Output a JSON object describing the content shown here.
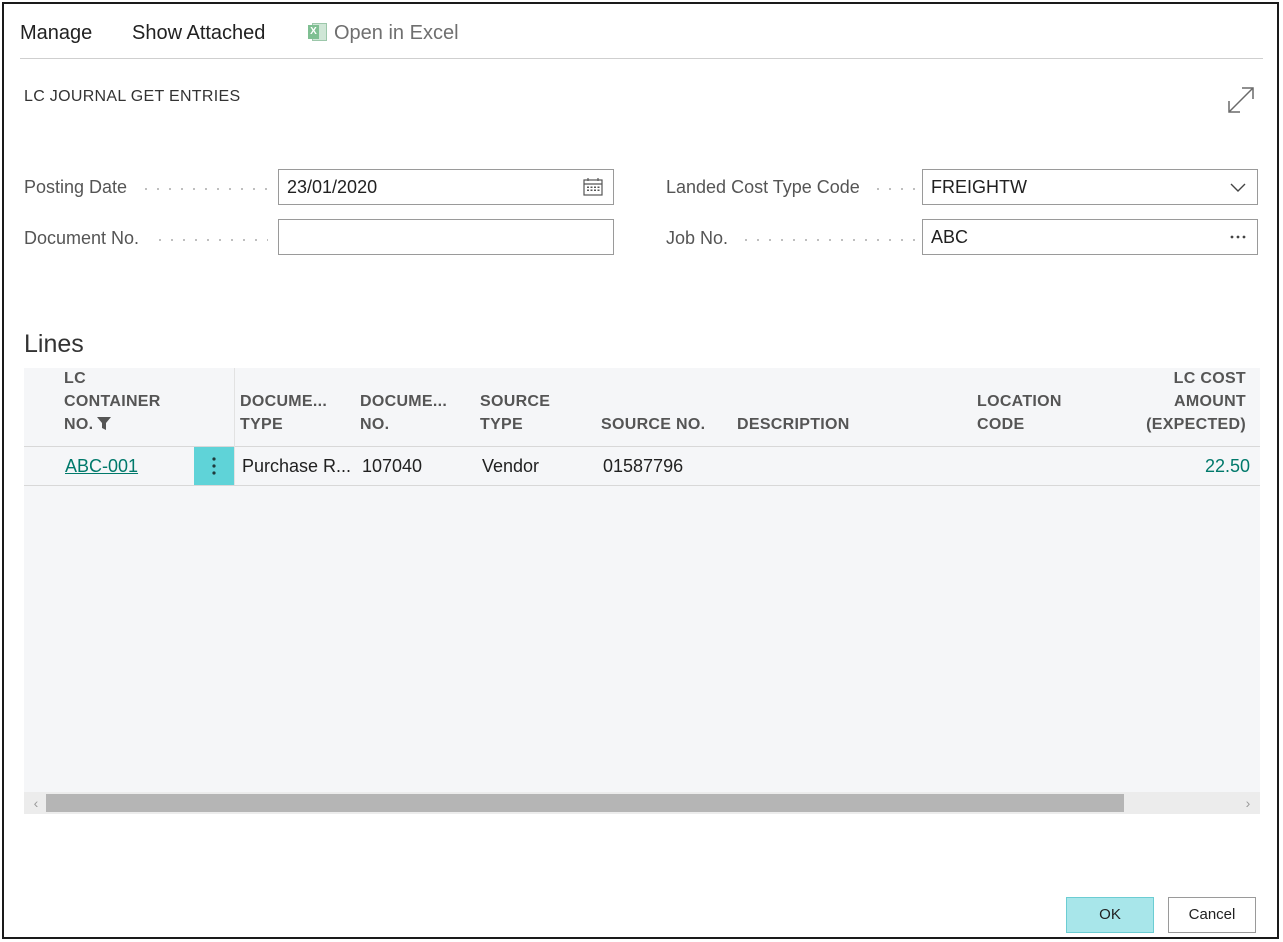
{
  "actionbar": {
    "manage": "Manage",
    "show_attached": "Show Attached",
    "open_in_excel": "Open in Excel"
  },
  "page": {
    "caption": "LC JOURNAL GET ENTRIES"
  },
  "fields": {
    "posting_date": {
      "label": "Posting Date",
      "value": "23/01/2020"
    },
    "document_no": {
      "label": "Document No.",
      "value": ""
    },
    "landed_cost_type_code": {
      "label": "Landed Cost Type Code",
      "value": "FREIGHTW"
    },
    "job_no": {
      "label": "Job No.",
      "value": "ABC"
    }
  },
  "lines": {
    "title": "Lines",
    "columns": {
      "lc_container_no": [
        "LC",
        "CONTAINER",
        "NO."
      ],
      "document_type": [
        "DOCUME...",
        "TYPE"
      ],
      "document_no": [
        "DOCUME...",
        "NO."
      ],
      "source_type": [
        "SOURCE",
        "TYPE"
      ],
      "source_no": [
        "SOURCE NO."
      ],
      "description": [
        "DESCRIPTION"
      ],
      "location_code": [
        "LOCATION",
        "CODE"
      ],
      "lc_cost_amount": [
        "LC COST",
        "AMOUNT",
        "(EXPECTED)"
      ]
    },
    "rows": [
      {
        "lc_container_no": "ABC-001",
        "document_type": "Purchase R...",
        "document_no": "107040",
        "source_type": "Vendor",
        "source_no": "01587796",
        "description": "",
        "location_code": "",
        "lc_cost_amount": "22.50"
      }
    ]
  },
  "buttons": {
    "ok": "OK",
    "cancel": "Cancel"
  },
  "colors": {
    "accent": "#5fd3d8",
    "link": "#00796b",
    "ok_button": "#a8e6ea"
  }
}
